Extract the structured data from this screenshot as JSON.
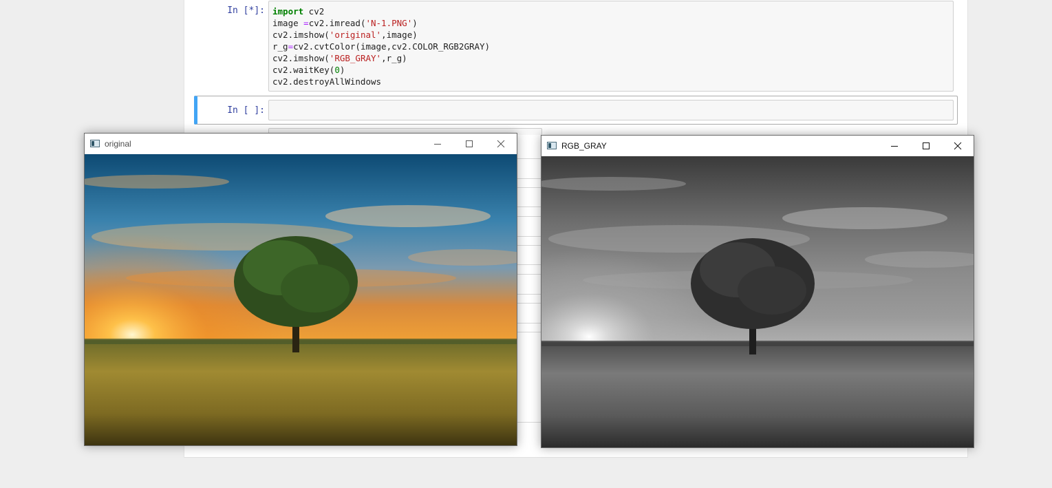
{
  "notebook": {
    "cell1": {
      "prompt": "In [*]:",
      "code_lines": [
        [
          {
            "t": "import",
            "c": "kw"
          },
          {
            "t": " cv2",
            "c": ""
          }
        ],
        [
          {
            "t": "image ",
            "c": ""
          },
          {
            "t": "=",
            "c": "op"
          },
          {
            "t": "cv2.imread(",
            "c": ""
          },
          {
            "t": "'N-1.PNG'",
            "c": "str"
          },
          {
            "t": ")",
            "c": ""
          }
        ],
        [
          {
            "t": "cv2.imshow(",
            "c": ""
          },
          {
            "t": "'original'",
            "c": "str"
          },
          {
            "t": ",image)",
            "c": ""
          }
        ],
        [
          {
            "t": "r_g",
            "c": ""
          },
          {
            "t": "=",
            "c": "op"
          },
          {
            "t": "cv2.cvtColor(image,cv2.COLOR_RGB2GRAY)",
            "c": ""
          }
        ],
        [
          {
            "t": "cv2.imshow(",
            "c": ""
          },
          {
            "t": "'RGB_GRAY'",
            "c": "str"
          },
          {
            "t": ",r_g)",
            "c": ""
          }
        ],
        [
          {
            "t": "cv2.waitKey(",
            "c": ""
          },
          {
            "t": "0",
            "c": "num"
          },
          {
            "t": ")",
            "c": ""
          }
        ],
        [
          {
            "t": "cv2.destroyAllWindows",
            "c": ""
          }
        ]
      ]
    },
    "cell2": {
      "prompt": "In [ ]:"
    }
  },
  "windows": {
    "original": {
      "title": "original"
    },
    "gray": {
      "title": "RGB_GRAY"
    }
  },
  "colors": {
    "prompt": "#303f9f",
    "selected_border": "#42a5f5",
    "keyword": "#008000",
    "string": "#ba2121"
  }
}
